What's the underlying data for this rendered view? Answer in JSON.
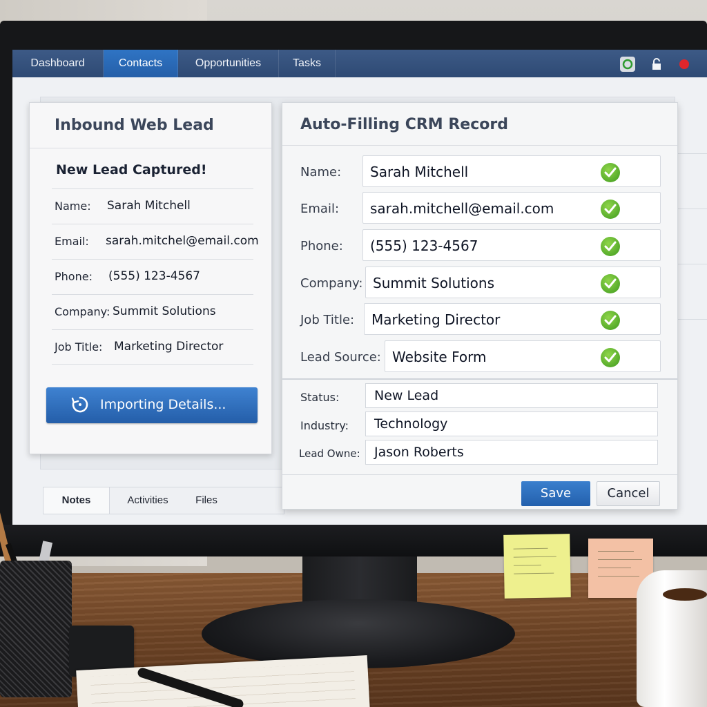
{
  "nav": {
    "tabs": [
      {
        "label": "Dashboard"
      },
      {
        "label": "Contacts"
      },
      {
        "label": "Opportunities"
      },
      {
        "label": "Tasks"
      }
    ],
    "active_tab": "Contacts"
  },
  "lead_card": {
    "title": "Inbound Web Lead",
    "subtitle": "New Lead Captured!",
    "fields": [
      {
        "label": "Name:",
        "value": "Sarah Mitchell"
      },
      {
        "label": "Email:",
        "value": "sarah.mitchel@email.com"
      },
      {
        "label": "Phone:",
        "value": "(555) 123-4567"
      },
      {
        "label": "Company:",
        "value": "Summit Solutions"
      },
      {
        "label": "Job Title:",
        "value": "Marketing Director"
      }
    ],
    "import_button": "Importing Details..."
  },
  "crm_card": {
    "title": "Auto-Filling CRM Record",
    "verified_fields": [
      {
        "label": "Name:",
        "value": "Sarah Mitchell",
        "verified": true
      },
      {
        "label": "Email:",
        "value": "sarah.mitchell@email.com",
        "verified": true
      },
      {
        "label": "Phone:",
        "value": "(555) 123-4567",
        "verified": true
      },
      {
        "label": "Company:",
        "value": "Summit Solutions",
        "verified": true
      },
      {
        "label": "Job Title:",
        "value": "Marketing Director",
        "verified": true
      },
      {
        "label": "Lead Source:",
        "value": "Website Form",
        "verified": true
      }
    ],
    "extra_fields": [
      {
        "label": "Status:",
        "value": "New Lead"
      },
      {
        "label": "Industry:",
        "value": "Technology"
      },
      {
        "label": "Lead Owne:",
        "value": "Jason Roberts"
      }
    ],
    "save_button": "Save",
    "cancel_button": "Cancel"
  },
  "bottom_tabs": [
    {
      "label": "Notes"
    },
    {
      "label": "Activities"
    },
    {
      "label": "Files"
    }
  ],
  "icons": {
    "import": "refresh-icon",
    "check": "check-circle-icon",
    "window_controls": [
      "status-icon",
      "lock-icon",
      "close-icon"
    ]
  },
  "colors": {
    "nav_bar": "#2e4a74",
    "accent": "#2f74c4",
    "check": "#4caf22",
    "close_dot": "#e0262b"
  }
}
